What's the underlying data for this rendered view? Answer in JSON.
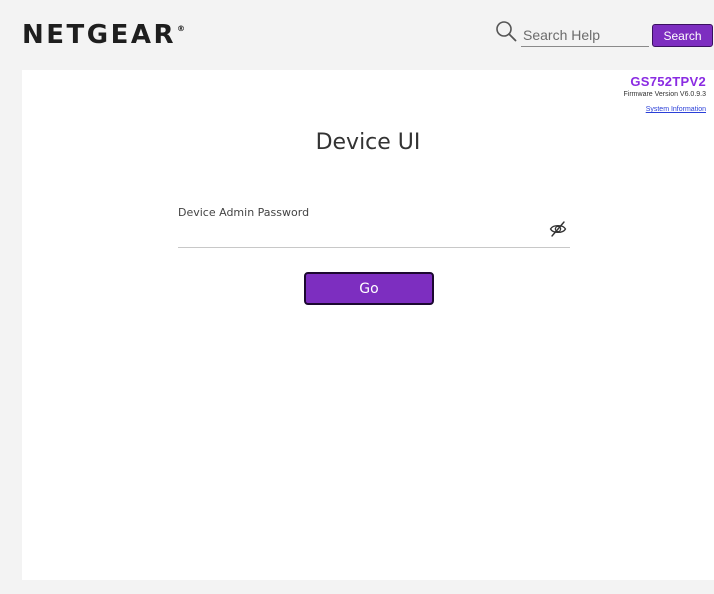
{
  "header": {
    "logo_text": "NETGEAR",
    "logo_mark": "®",
    "search_placeholder": "Search Help",
    "search_button": "Search",
    "icons": {
      "search": "search-icon"
    }
  },
  "device": {
    "model": "GS752TPV2",
    "firmware": "Firmware Version  V6.0.9.3",
    "system_info_link": "System Information"
  },
  "login": {
    "title": "Device UI",
    "password_label": "Device Admin Password",
    "password_value": "",
    "go_button": "Go",
    "icons": {
      "visibility_toggle": "eye-slash-icon"
    }
  },
  "colors": {
    "accent": "#7d2ec0",
    "model_text": "#8a2be2",
    "link": "#2a3fd8",
    "background": "#f3f3f3",
    "panel": "#ffffff"
  }
}
